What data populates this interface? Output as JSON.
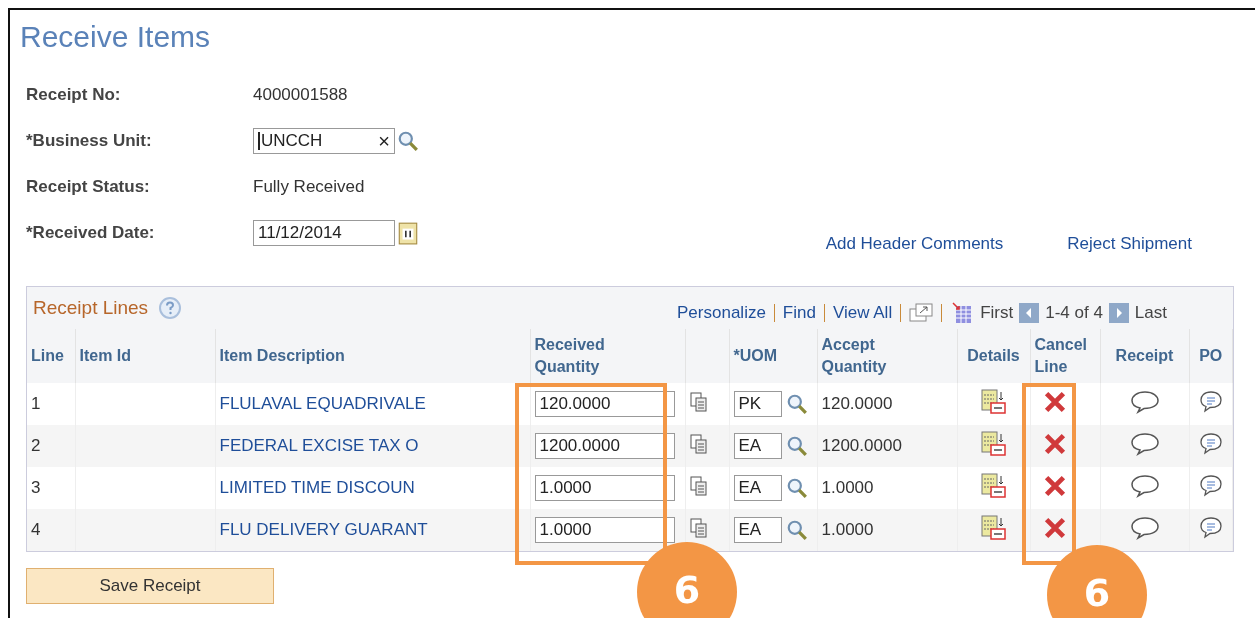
{
  "page": {
    "title": "Receive Items"
  },
  "header_fields": [
    {
      "kind": "text",
      "label": "Receipt No:",
      "value": "4000001588"
    },
    {
      "kind": "lookup",
      "label": "*Business Unit:",
      "value": "UNCCH",
      "clear": "×"
    },
    {
      "kind": "text",
      "label": "Receipt Status:",
      "value": "Fully Received"
    },
    {
      "kind": "date",
      "label": "*Received Date:",
      "value": "11/12/2014"
    }
  ],
  "header_links": [
    "Add Header Comments",
    "Reject Shipment"
  ],
  "grid": {
    "title": "Receipt Lines",
    "toolbar_links": [
      "Personalize",
      "Find",
      "View All"
    ],
    "first": "First",
    "range": "1-4 of 4",
    "last": "Last",
    "columns": [
      "Line",
      "Item Id",
      "Item Description",
      "Received Quantity",
      "*UOM",
      "Accept Quantity",
      "Details",
      "Cancel Line",
      "Receipt",
      "PO"
    ],
    "rows": [
      {
        "line": "1",
        "description": "FLULAVAL EQUADRIVALE",
        "received_quantity": "120.0000",
        "uom": "PK",
        "accept_quantity": "120.0000"
      },
      {
        "line": "2",
        "description": "FEDERAL EXCISE TAX O",
        "received_quantity": "1200.0000",
        "uom": "EA",
        "accept_quantity": "1200.0000"
      },
      {
        "line": "3",
        "description": "LIMITED TIME DISCOUN",
        "received_quantity": "1.0000",
        "uom": "EA",
        "accept_quantity": "1.0000"
      },
      {
        "line": "4",
        "description": "FLU DELIVERY GUARANT",
        "received_quantity": "1.0000",
        "uom": "EA",
        "accept_quantity": "1.0000"
      }
    ]
  },
  "buttons": [
    "Save Receipt"
  ],
  "callouts": [
    {
      "label": "6"
    },
    {
      "label": "6"
    }
  ]
}
